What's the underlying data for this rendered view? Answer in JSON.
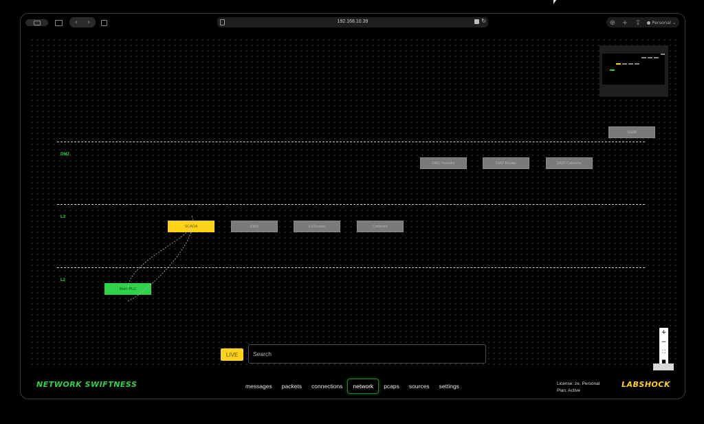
{
  "browser": {
    "url": "192.168.10.39",
    "profile": "Personal"
  },
  "zones": [
    {
      "label": "DMZ"
    },
    {
      "label": "L3"
    },
    {
      "label": "L2"
    }
  ],
  "nodes": {
    "siem": "SIEM",
    "dmz_transfer": "DMZ-Transfer",
    "dmz_router": "DMZ-Router",
    "dmz_collector": "DMZ-Collector",
    "scada": "SCADA",
    "ews": "EWS",
    "l3_router": "L3-Router",
    "collector": "Collector",
    "main_plc": "Main-PLC"
  },
  "colors": {
    "accent_green": "#2fd24a",
    "accent_yellow": "#ffd21a",
    "node_gray": "#7a7a7a"
  },
  "controls": {
    "live_label": "LIVE",
    "search_placeholder": "Search"
  },
  "footer": {
    "brand_left": "NETWORK SWIFTNESS",
    "brand_right": "LABSHOCK",
    "nav": [
      "messages",
      "packets",
      "connections",
      "network",
      "pcaps",
      "sources",
      "settings"
    ],
    "active_nav": "network",
    "license_line": "License: ze, Personal",
    "plan_line": "Plan: Active"
  }
}
